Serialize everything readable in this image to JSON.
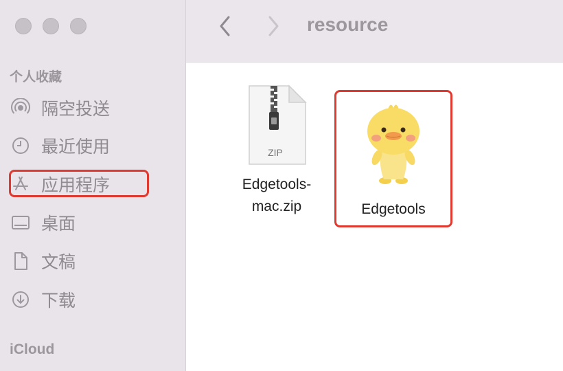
{
  "window": {
    "path_title": "resource"
  },
  "sidebar": {
    "favorites_label": "个人收藏",
    "items": [
      {
        "label": "隔空投送",
        "icon": "airdrop-icon"
      },
      {
        "label": "最近使用",
        "icon": "clock-icon"
      },
      {
        "label": "应用程序",
        "icon": "applications-icon",
        "highlighted": true
      },
      {
        "label": "桌面",
        "icon": "desktop-icon"
      },
      {
        "label": "文稿",
        "icon": "document-icon"
      },
      {
        "label": "下载",
        "icon": "download-icon"
      }
    ],
    "icloud_label": "iCloud"
  },
  "files": [
    {
      "name_line1": "Edgetools-",
      "name_line2": "mac.zip",
      "icon": "zip-file-icon",
      "badge": "ZIP"
    },
    {
      "name_line1": "Edgetools",
      "icon": "duck-app-icon",
      "highlighted": true
    }
  ],
  "colors": {
    "highlight": "#e0392f",
    "sidebar_bg": "#e9e4ea",
    "toolbar_bg": "#ebe6ec"
  }
}
